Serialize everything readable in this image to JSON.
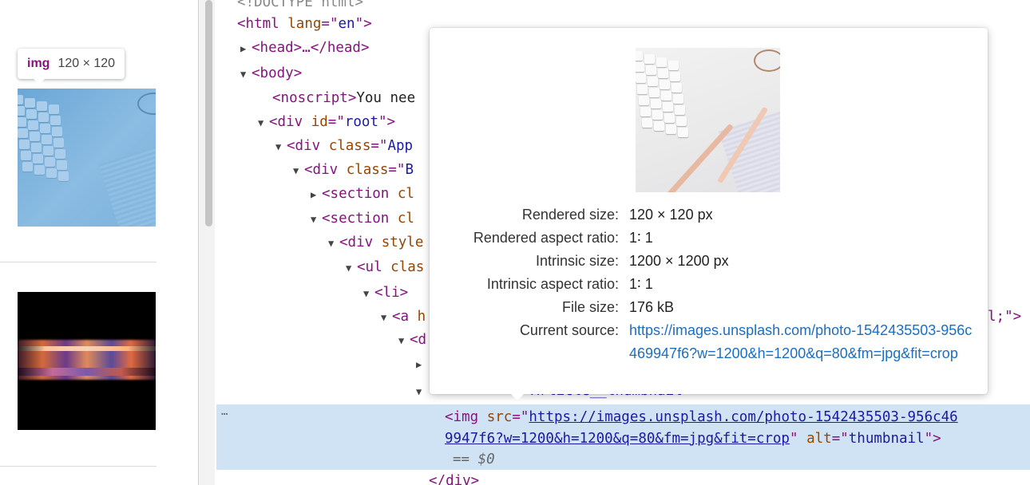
{
  "element_tooltip": {
    "tag": "img",
    "dimensions": "120 × 120"
  },
  "dom_lines": [
    {
      "text": "<!DOCTYPE html>"
    },
    {
      "open": "html",
      "attr": "lang",
      "value": "en"
    },
    {
      "collapsed": "<head>…</head>"
    },
    {
      "open": "body"
    },
    {
      "noscript": "You nee"
    },
    {
      "open": "div",
      "attr": "id",
      "value": "root"
    },
    {
      "open": "div",
      "attr": "class",
      "value": "App"
    },
    {
      "open": "div",
      "attr": "class",
      "value": "B"
    },
    {
      "open": "section",
      "attr": "cl"
    },
    {
      "open": "section",
      "attr": "cl"
    },
    {
      "open": "div",
      "attr": "style"
    },
    {
      "open": "ul",
      "attr": "clas"
    },
    {
      "open": "li"
    },
    {
      "open": "a",
      "attr": "h",
      "tail": "l;\">"
    },
    {
      "open": "d"
    },
    {
      "text": "."
    },
    {
      "text": "Article__thumbnail\">"
    }
  ],
  "selected_node": {
    "tag": "img",
    "src_attr": "src",
    "src": "https://images.unsplash.com/photo-1542435503-956c46",
    "src_cont": "9947f6?w=1200&h=1200&q=80&fm=jpg&fit=crop",
    "alt_attr": "alt",
    "alt": "thumbnail",
    "console_ref": "== $0"
  },
  "closing_div": "</div>",
  "popover": {
    "rows": [
      {
        "label": "Rendered size:",
        "value": "120 × 120 px"
      },
      {
        "label": "Rendered aspect ratio:",
        "value": "1∶ 1"
      },
      {
        "label": "Intrinsic size:",
        "value": "1200 × 1200 px"
      },
      {
        "label": "Intrinsic aspect ratio:",
        "value": "1∶ 1"
      },
      {
        "label": "File size:",
        "value": "176 kB"
      }
    ],
    "source_label": "Current source:",
    "source_url": "https://images.unsplash.com/photo-1542435503-956c469947f6?w=1200&h=1200&q=80&fm=jpg&fit=crop"
  },
  "colors": {
    "tag": "#881280",
    "attr_name": "#994500",
    "attr_value": "#1a1aa6",
    "selection": "#cfe3f5",
    "link": "#1a6fc4"
  }
}
